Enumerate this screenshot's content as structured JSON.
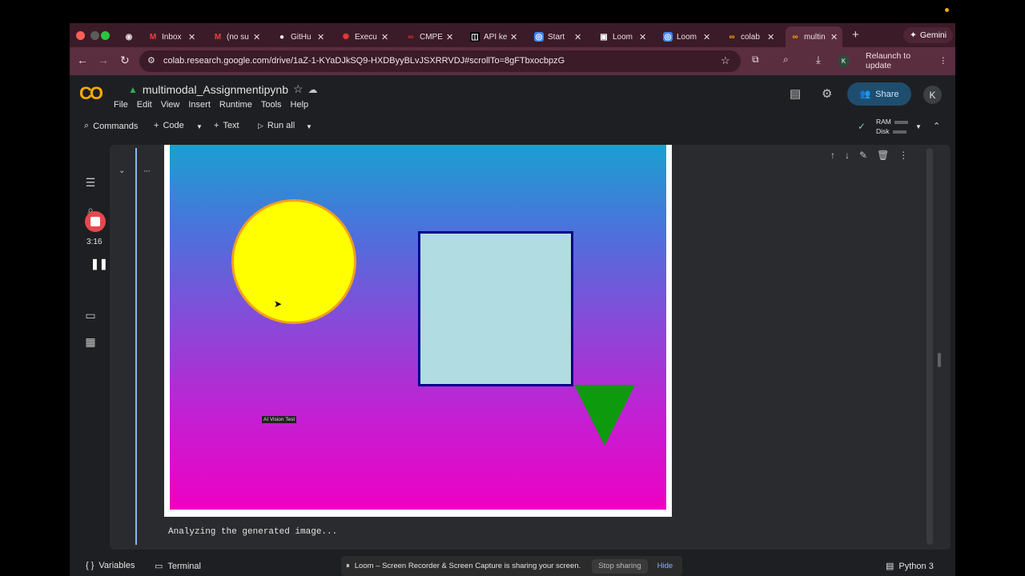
{
  "browser": {
    "tabs": [
      {
        "label": "Inbox",
        "icon": "gmail-icon",
        "active": false
      },
      {
        "label": "(no su",
        "icon": "gmail-icon",
        "active": false
      },
      {
        "label": "GitHu",
        "icon": "github-icon",
        "active": false
      },
      {
        "label": "Execu",
        "icon": "ci-icon",
        "active": false
      },
      {
        "label": "CMPE",
        "icon": "course-icon",
        "active": false
      },
      {
        "label": "API ke",
        "icon": "api-icon",
        "active": false
      },
      {
        "label": "Start",
        "icon": "dashboard-icon",
        "active": false
      },
      {
        "label": "Loom",
        "icon": "loom-icon",
        "active": false
      },
      {
        "label": "Loom",
        "icon": "loom-icon",
        "active": false
      },
      {
        "label": "colab",
        "icon": "colab-icon",
        "active": false
      },
      {
        "label": "multin",
        "icon": "colab-icon",
        "active": true
      }
    ],
    "gemini_label": "Gemini",
    "url": "colab.research.google.com/drive/1aZ-1-KYaDJkSQ9-HXDByyBLvJSXRRVDJ#scrollTo=8gFTbxocbpzG",
    "profile_initial": "K",
    "relaunch_label": "Relaunch to update"
  },
  "colab": {
    "doc_name": "multimodal_Assignmentipynb",
    "menu": [
      "File",
      "Edit",
      "View",
      "Insert",
      "Runtime",
      "Tools",
      "Help"
    ],
    "share_label": "Share",
    "avatar_initial": "K",
    "toolbar": {
      "commands": "Commands",
      "code": "Code",
      "text": "Text",
      "run_all": "Run all",
      "ram": "RAM",
      "disk": "Disk"
    },
    "recording_timer": "3:16",
    "plot_label": "AI Vision Test",
    "output_text": "Analyzing the generated image...",
    "status": {
      "variables": "Variables",
      "terminal": "Terminal",
      "kernel": "Python 3"
    }
  },
  "loom_bar": {
    "message": "Loom – Screen Recorder & Screen Capture is sharing your screen.",
    "stop_label": "Stop sharing",
    "hide_label": "Hide"
  },
  "colors": {
    "accent": "#8ab4f8",
    "tabstrip": "#3b1b28",
    "toolbar": "#5a2d3f",
    "sun": "#ffff00",
    "square": "#b0dce2",
    "triangle": "#0d9a0d"
  }
}
